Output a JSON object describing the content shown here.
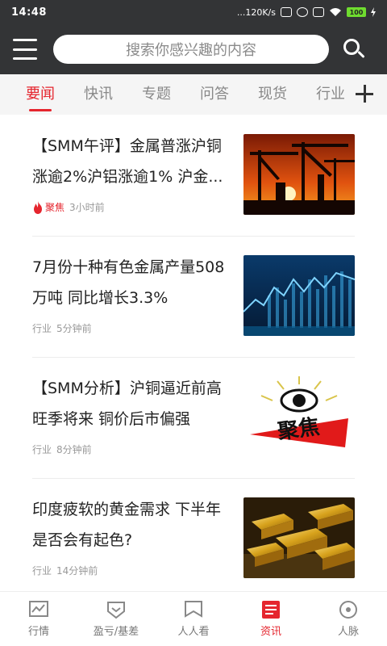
{
  "status_bar": {
    "time": "14:48",
    "network_speed": "...120K/s",
    "battery": "100"
  },
  "header": {
    "search_placeholder": "搜索你感兴趣的内容"
  },
  "tabs": [
    {
      "label": "要闻",
      "active": true
    },
    {
      "label": "快讯",
      "active": false
    },
    {
      "label": "专题",
      "active": false
    },
    {
      "label": "问答",
      "active": false
    },
    {
      "label": "现货",
      "active": false
    },
    {
      "label": "行业",
      "active": false
    }
  ],
  "articles": [
    {
      "title": "【SMM午评】金属普涨沪铜涨逾2%沪铝涨逾1% 沪金...",
      "tag": "聚焦",
      "time": "3小时前",
      "hot": true
    },
    {
      "title": "7月份十种有色金属产量508万吨 同比增长3.3%",
      "tag": "行业",
      "time": "5分钟前",
      "hot": false
    },
    {
      "title": "【SMM分析】沪铜逼近前高 旺季将来 铜价后市偏强",
      "tag": "行业",
      "time": "8分钟前",
      "hot": false
    },
    {
      "title": "印度疲软的黄金需求 下半年是否会有起色?",
      "tag": "行业",
      "time": "14分钟前",
      "hot": false
    }
  ],
  "thumb_text": {
    "focus_label": "聚焦"
  },
  "bottom_nav": [
    {
      "label": "行情",
      "icon": "chart-icon",
      "active": false
    },
    {
      "label": "盈亏/基差",
      "icon": "shield-icon",
      "active": false
    },
    {
      "label": "人人看",
      "icon": "bookmark-icon",
      "active": false
    },
    {
      "label": "资讯",
      "icon": "news-icon",
      "active": true
    },
    {
      "label": "人脉",
      "icon": "compass-icon",
      "active": false
    }
  ],
  "colors": {
    "accent": "#e5252e",
    "header_bg": "#333436"
  }
}
